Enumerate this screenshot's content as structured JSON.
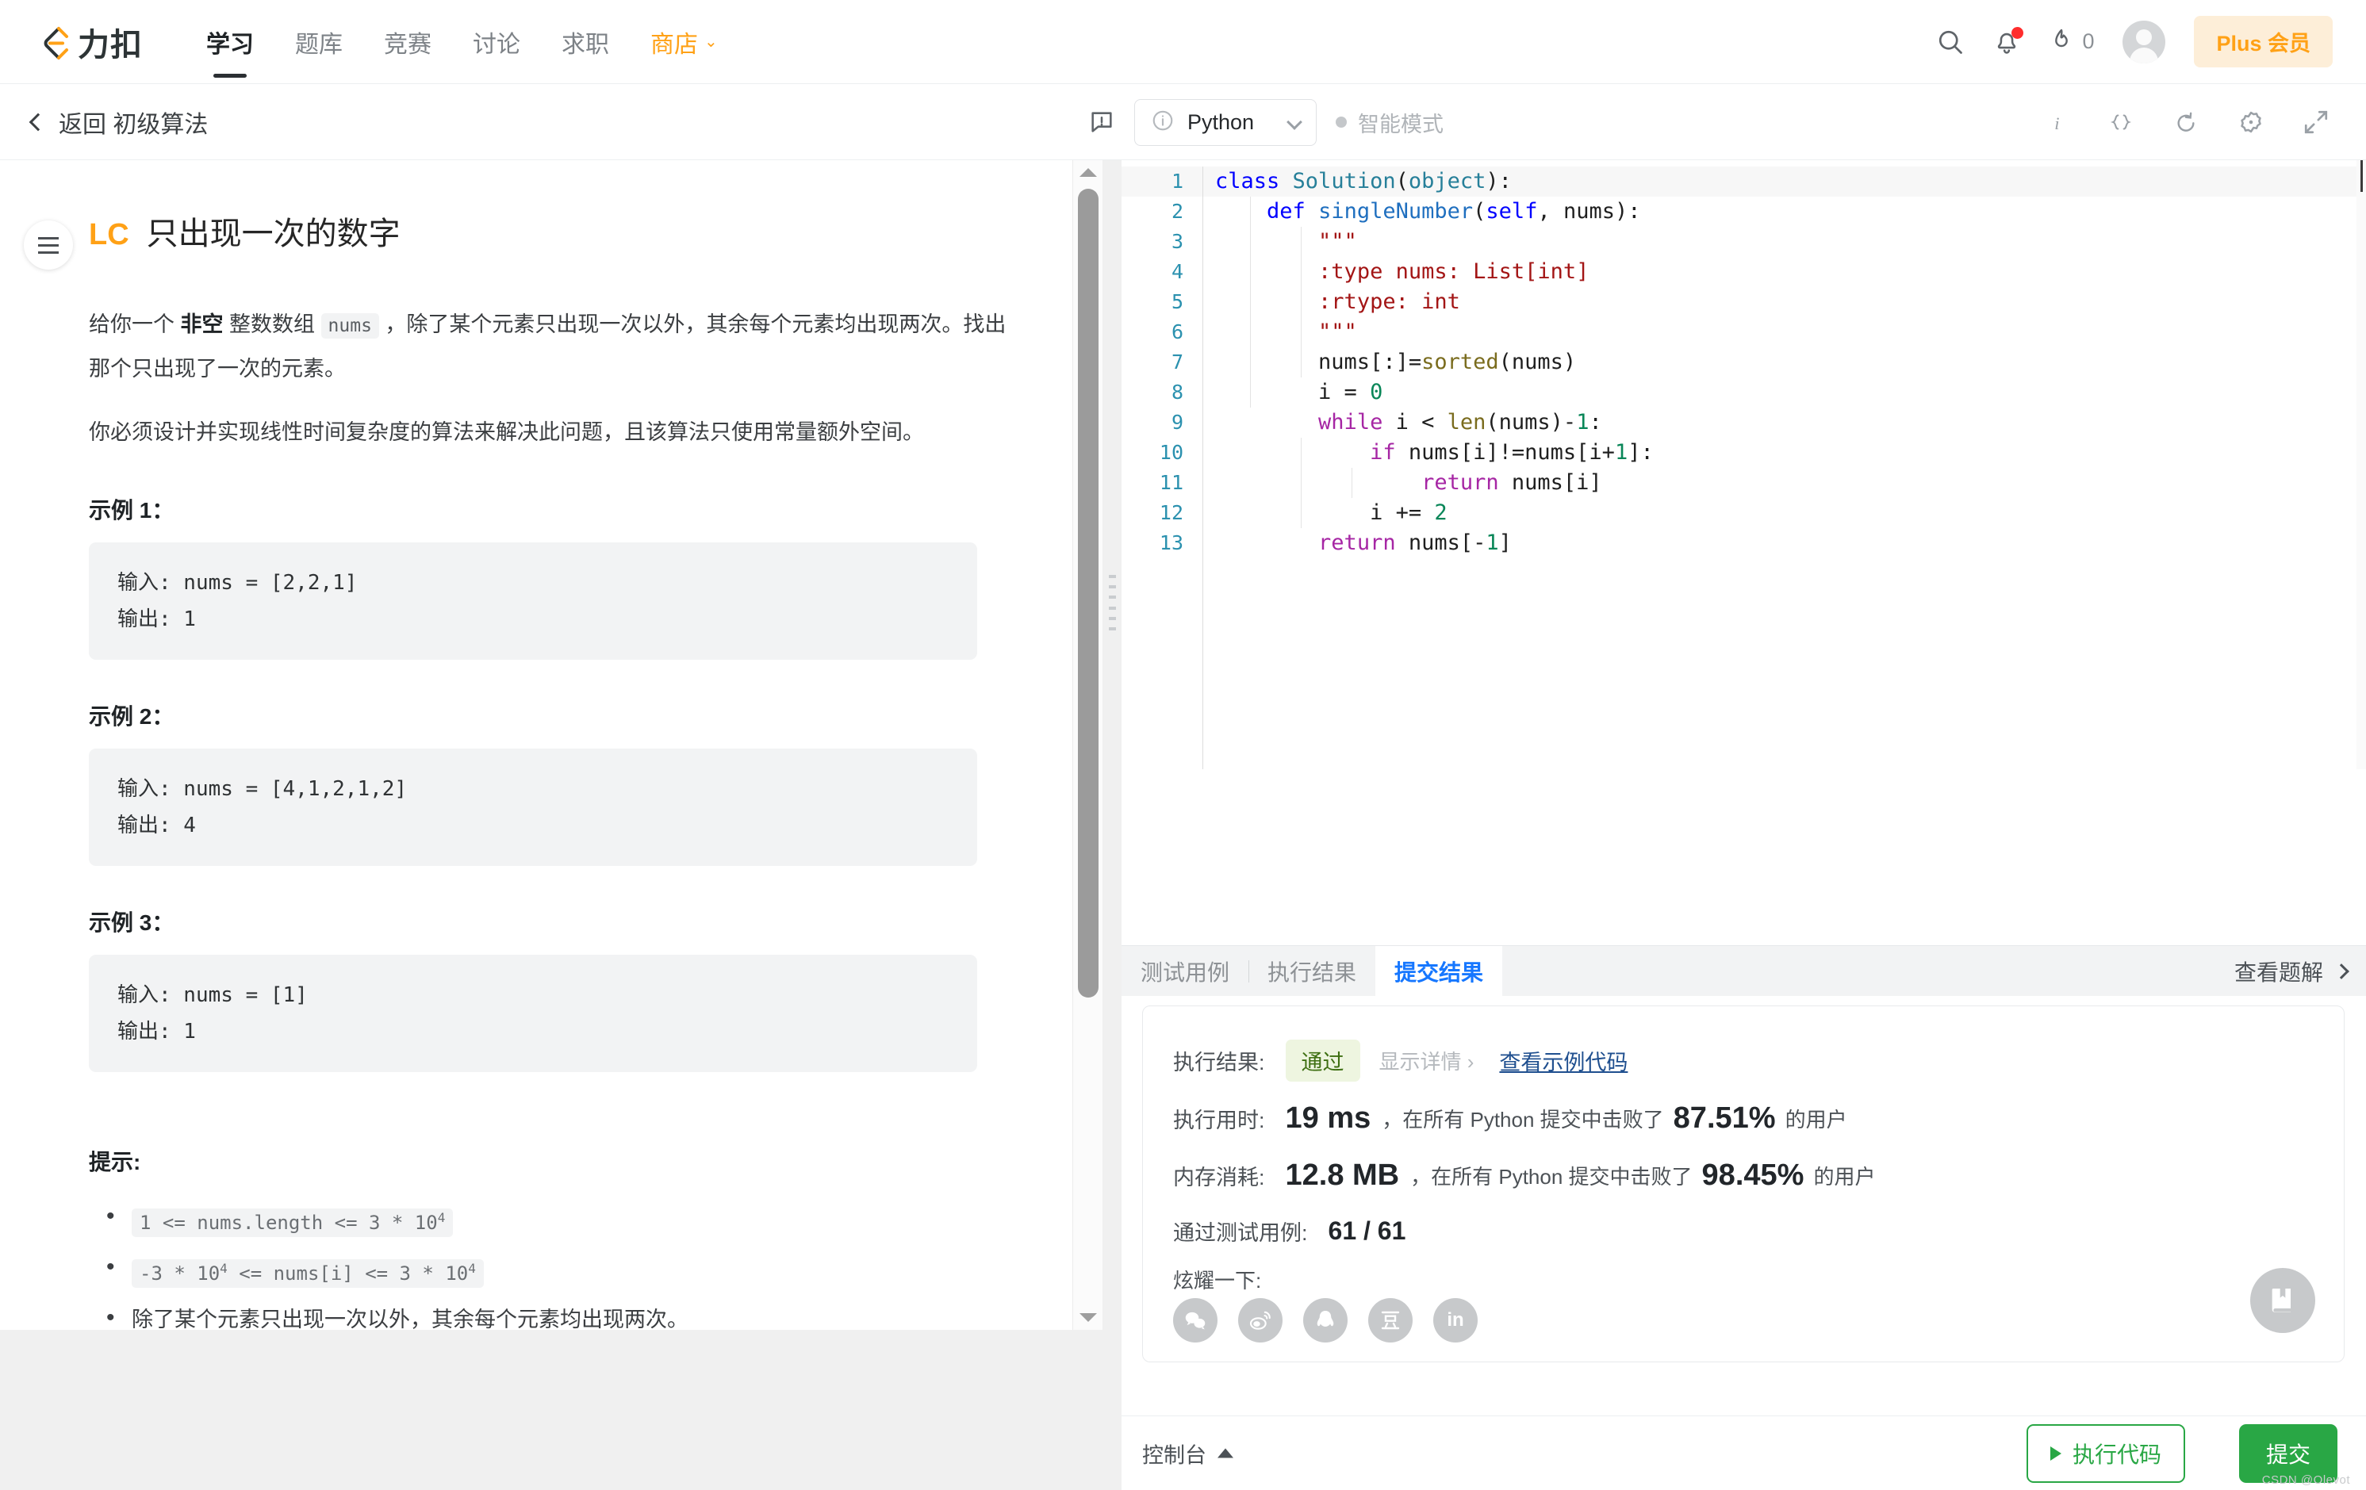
{
  "topnav": {
    "logo_text": "力扣",
    "logo_icon": "leetcode-logo-icon",
    "items": [
      {
        "label": "学习",
        "active": true
      },
      {
        "label": "题库",
        "active": false
      },
      {
        "label": "竞赛",
        "active": false
      },
      {
        "label": "讨论",
        "active": false
      },
      {
        "label": "求职",
        "active": false
      },
      {
        "label": "商店",
        "active": false,
        "accent": true,
        "caret": "⌄"
      }
    ],
    "search_icon": "search-icon",
    "bell_icon": "notification-bell-icon",
    "streak_icon": "flame-icon",
    "streak_count": "0",
    "avatar": "user-avatar",
    "plus_label": "Plus 会员"
  },
  "subheader": {
    "back_label": "返回 初级算法",
    "note_icon": "note-icon",
    "language": "Python",
    "lang_info_icon": "info-circle-icon",
    "smart_mode_label": "智能模式",
    "tools": [
      {
        "name": "info-icon",
        "glyph": "i"
      },
      {
        "name": "braces-icon",
        "glyph": "{}"
      },
      {
        "name": "reset-icon",
        "glyph": "↺"
      },
      {
        "name": "settings-gear-icon",
        "glyph": "⚙"
      },
      {
        "name": "fullscreen-icon",
        "glyph": "⤢"
      }
    ]
  },
  "problem": {
    "lc_tag": "LC",
    "title": "只出现一次的数字",
    "desc_1_a": "给你一个 ",
    "desc_1_b": "非空",
    "desc_1_c": " 整数数组 ",
    "desc_1_code": "nums",
    "desc_1_d": " ，除了某个元素只出现一次以外，其余每个元素均出现两次。找出那个只出现了一次的元素。",
    "desc_2": "你必须设计并实现线性时间复杂度的算法来解决此问题，且该算法只使用常量额外空间。",
    "examples": [
      {
        "head": "示例 1：",
        "body": "输入: nums = [2,2,1]\n输出: 1"
      },
      {
        "head": "示例 2：",
        "body": "输入: nums = [4,1,2,1,2]\n输出: 4"
      },
      {
        "head": "示例 3：",
        "body": "输入: nums = [1]\n输出: 1"
      }
    ],
    "hints_head": "提示:",
    "hint_1": "1 <= nums.length <= 3 * 10",
    "hint_1_sup": "4",
    "hint_2_a": "-3 * 10",
    "hint_2_sup_a": "4",
    "hint_2_b": " <= nums[i] <= 3 * 10",
    "hint_2_sup_b": "4",
    "hint_3": "除了某个元素只出现一次以外，其余每个元素均出现两次。"
  },
  "editor": {
    "line_numbers": [
      "1",
      "2",
      "3",
      "4",
      "5",
      "6",
      "7",
      "8",
      "9",
      "10",
      "11",
      "12",
      "13"
    ],
    "code_lines": [
      "class Solution(object):",
      "    def singleNumber(self, nums):",
      "        \"\"\"",
      "        :type nums: List[int]",
      "        :rtype: int",
      "        \"\"\"",
      "        nums[:]=sorted(nums)",
      "        i = 0",
      "        while i < len(nums)-1:",
      "            if nums[i]!=nums[i+1]:",
      "                return nums[i]",
      "            i += 2",
      "        return nums[-1]"
    ]
  },
  "results": {
    "tabs": [
      {
        "label": "测试用例",
        "active": false
      },
      {
        "label": "执行结果",
        "active": false
      },
      {
        "label": "提交结果",
        "active": true
      }
    ],
    "view_solution": "查看题解",
    "exec_result_label": "执行结果:",
    "verdict": "通过",
    "show_detail": "显示详情 ›",
    "sample_code_link": "查看示例代码",
    "runtime_label": "执行用时:",
    "runtime_value": "19 ms",
    "runtime_mid": "，在所有 Python 提交中击败了",
    "runtime_pct": "87.51%",
    "runtime_tail": "的用户",
    "memory_label": "内存消耗:",
    "memory_value": "12.8 MB",
    "memory_mid": "，在所有 Python 提交中击败了",
    "memory_pct": "98.45%",
    "memory_tail": "的用户",
    "testcases_label": "通过测试用例:",
    "testcases_value": "61 / 61",
    "share_label": "炫耀一下:",
    "share_icons": [
      {
        "name": "wechat-share-icon",
        "glyph": ""
      },
      {
        "name": "weibo-share-icon",
        "glyph": ""
      },
      {
        "name": "qq-share-icon",
        "glyph": ""
      },
      {
        "name": "douban-share-icon",
        "glyph": "豆"
      },
      {
        "name": "linkedin-share-icon",
        "glyph": "in"
      }
    ],
    "bookmark_icon": "bookmark-book-icon"
  },
  "bottom": {
    "console_label": "控制台",
    "run_label": "执行代码",
    "submit_label": "提交",
    "watermark": "CSDN @Olevot"
  },
  "colors": {
    "accent": "#ffa116",
    "tab_active": "#1677ff",
    "success": "#29a745",
    "verdict_bg": "#eef5e0",
    "verdict_fg": "#3e6f12"
  }
}
